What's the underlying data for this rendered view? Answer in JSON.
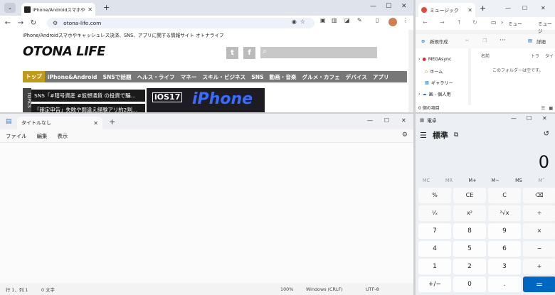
{
  "chrome": {
    "tab_title": "iPhone/Androidスマホやキャッシュ",
    "url": "otona-life.com",
    "tagline": "iPhone/Androidスマホやキャッシュレス決済、SNS、アプリに関する情報サイト オトナライフ",
    "logo": "OTONA LIFE",
    "menu": [
      "トップ",
      "iPhone&Android",
      "SNSで話題",
      "ヘルス・ライフ",
      "マネー",
      "スキル・ビジネス",
      "SNS",
      "動画・音楽",
      "グルメ・カフェ",
      "デバイス",
      "アプリ"
    ],
    "topics_label": "TOPICS",
    "headlines": [
      "SNS「#暗号資産 #仮想通貨 の投資で騙…",
      "「確定申告」失敗や間違え経験アリ約2割…"
    ],
    "banner_badge": "iOS17",
    "banner_text": "iPhone"
  },
  "explorer": {
    "tab_title": "ミュージック",
    "breadcrumb": "ミュー",
    "breadcrumb2": "ミュージ",
    "new_label": "新規作成",
    "details_label": "詳細",
    "col_name": "名前",
    "col_track": "トラ",
    "col_title": "タイ",
    "empty_text": "このフォルダーは空です。",
    "sidebar": [
      "MEGAsync",
      "ホーム",
      "ギャラリー",
      "画 - 個人用"
    ],
    "status": "0 個の項目"
  },
  "notepad": {
    "tab_title": "タイトルなし",
    "menu": [
      "ファイル",
      "編集",
      "表示"
    ],
    "status_pos": "行 1、列 1",
    "status_chars": "0 文字",
    "status_zoom": "100%",
    "status_eol": "Windows (CRLF)",
    "status_enc": "UTF-8"
  },
  "calc": {
    "title": "電卓",
    "mode": "標準",
    "display": "0",
    "memory": [
      "MC",
      "MR",
      "M+",
      "M−",
      "MS",
      "M˅"
    ],
    "keys": [
      [
        "%",
        "CE",
        "C",
        "⌫"
      ],
      [
        "¹⁄ₓ",
        "x²",
        "²√x",
        "÷"
      ],
      [
        "7",
        "8",
        "9",
        "×"
      ],
      [
        "4",
        "5",
        "6",
        "−"
      ],
      [
        "1",
        "2",
        "3",
        "+"
      ],
      [
        "+/−",
        "0",
        ".",
        "="
      ]
    ]
  }
}
